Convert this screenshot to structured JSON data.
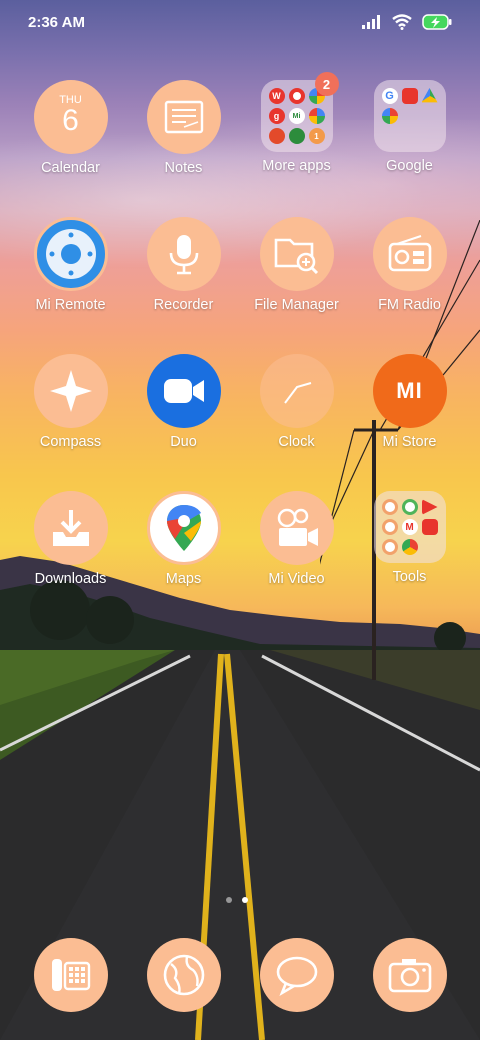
{
  "status_bar": {
    "time": "2:36 AM",
    "signal_icon": "signal-bars-icon",
    "wifi_icon": "wifi-icon",
    "battery_icon": "battery-charging-icon"
  },
  "apps": {
    "row1": [
      {
        "label": "Calendar",
        "day_name": "THU",
        "day_num": "6"
      },
      {
        "label": "Notes"
      },
      {
        "label": "More apps",
        "badge": "2",
        "minis": [
          "W",
          "",
          "",
          "g",
          "Mi",
          "",
          "",
          "",
          "1"
        ]
      },
      {
        "label": "Google"
      }
    ],
    "row2": [
      {
        "label": "Mi Remote"
      },
      {
        "label": "Recorder"
      },
      {
        "label": "File Manager"
      },
      {
        "label": "FM Radio"
      }
    ],
    "row3": [
      {
        "label": "Compass"
      },
      {
        "label": "Duo"
      },
      {
        "label": "Clock"
      },
      {
        "label": "Mi Store",
        "logo": "MI"
      }
    ],
    "row4": [
      {
        "label": "Downloads"
      },
      {
        "label": "Maps"
      },
      {
        "label": "Mi Video"
      },
      {
        "label": "Tools"
      }
    ]
  },
  "dock": [
    {
      "icon": "phone-dialer-icon"
    },
    {
      "icon": "browser-globe-icon"
    },
    {
      "icon": "messages-icon"
    },
    {
      "icon": "camera-icon"
    }
  ],
  "colors": {
    "icon_bg": "#fbbd93",
    "badge": "#f0705a",
    "mi_orange": "#f06a1a",
    "duo_blue": "#1a6fe0"
  }
}
